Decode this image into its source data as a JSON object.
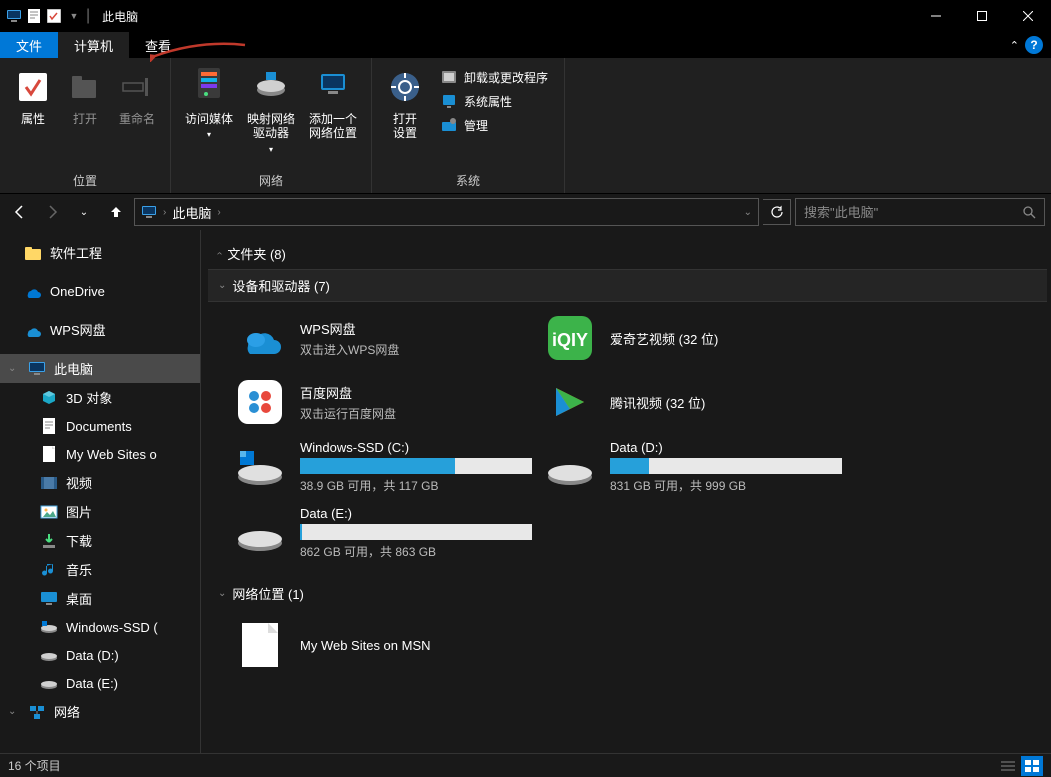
{
  "titlebar": {
    "title": "此电脑"
  },
  "ribbon": {
    "tabs": {
      "file": "文件",
      "computer": "计算机",
      "view": "查看"
    },
    "groups": {
      "location": {
        "label": "位置",
        "properties": "属性",
        "open": "打开",
        "rename": "重命名"
      },
      "network": {
        "label": "网络",
        "access_media": "访问媒体",
        "map_drive": "映射网络\n驱动器",
        "add_location": "添加一个\n网络位置"
      },
      "system": {
        "label": "系统",
        "open_settings": "打开\n设置",
        "uninstall": "卸载或更改程序",
        "sys_props": "系统属性",
        "manage": "管理"
      }
    }
  },
  "nav": {
    "breadcrumb": "此电脑",
    "search_placeholder": "搜索\"此电脑\""
  },
  "sidebar": {
    "items": [
      {
        "label": "软件工程",
        "icon": "folder"
      },
      {
        "label": "OneDrive",
        "icon": "onedrive"
      },
      {
        "label": "WPS网盘",
        "icon": "wps"
      },
      {
        "label": "此电脑",
        "icon": "pc",
        "selected": true,
        "expandable": true
      },
      {
        "label": "3D 对象",
        "icon": "3d",
        "child": true
      },
      {
        "label": "Documents",
        "icon": "doc",
        "child": true
      },
      {
        "label": "My Web Sites on MSN",
        "icon": "file",
        "child": true,
        "truncated": "My Web Sites o"
      },
      {
        "label": "视频",
        "icon": "video",
        "child": true
      },
      {
        "label": "图片",
        "icon": "pic",
        "child": true
      },
      {
        "label": "下载",
        "icon": "download",
        "child": true
      },
      {
        "label": "音乐",
        "icon": "music",
        "child": true
      },
      {
        "label": "桌面",
        "icon": "desktop",
        "child": true
      },
      {
        "label": "Windows-SSD (C:)",
        "icon": "drive-win",
        "child": true,
        "truncated": "Windows-SSD ("
      },
      {
        "label": "Data (D:)",
        "icon": "drive",
        "child": true
      },
      {
        "label": "Data (E:)",
        "icon": "drive",
        "child": true
      },
      {
        "label": "网络",
        "icon": "network",
        "expandable": true
      }
    ]
  },
  "content": {
    "groups": {
      "folders": {
        "label": "文件夹 (8)",
        "collapsed": true
      },
      "devices": {
        "label": "设备和驱动器 (7)",
        "collapsed": false
      },
      "netloc": {
        "label": "网络位置 (1)",
        "collapsed": false
      }
    },
    "devices": [
      {
        "type": "app",
        "title": "WPS网盘",
        "sub": "双击进入WPS网盘",
        "icon": "wps-cloud"
      },
      {
        "type": "app",
        "title": "爱奇艺视频 (32 位)",
        "sub": "",
        "icon": "iqiyi"
      },
      {
        "type": "app",
        "title": "百度网盘",
        "sub": "双击运行百度网盘",
        "icon": "baidu"
      },
      {
        "type": "app",
        "title": "腾讯视频 (32 位)",
        "sub": "",
        "icon": "tencent"
      },
      {
        "type": "drive",
        "title": "Windows-SSD (C:)",
        "free": "38.9 GB 可用，共 117 GB",
        "fill": 67,
        "icon": "drive-win"
      },
      {
        "type": "drive",
        "title": "Data (D:)",
        "free": "831 GB 可用，共 999 GB",
        "fill": 17,
        "icon": "drive"
      },
      {
        "type": "drive",
        "title": "Data (E:)",
        "free": "862 GB 可用，共 863 GB",
        "fill": 1,
        "icon": "drive"
      }
    ],
    "netloc": [
      {
        "title": "My Web Sites on MSN",
        "icon": "file"
      }
    ]
  },
  "statusbar": {
    "text": "16 个项目"
  }
}
